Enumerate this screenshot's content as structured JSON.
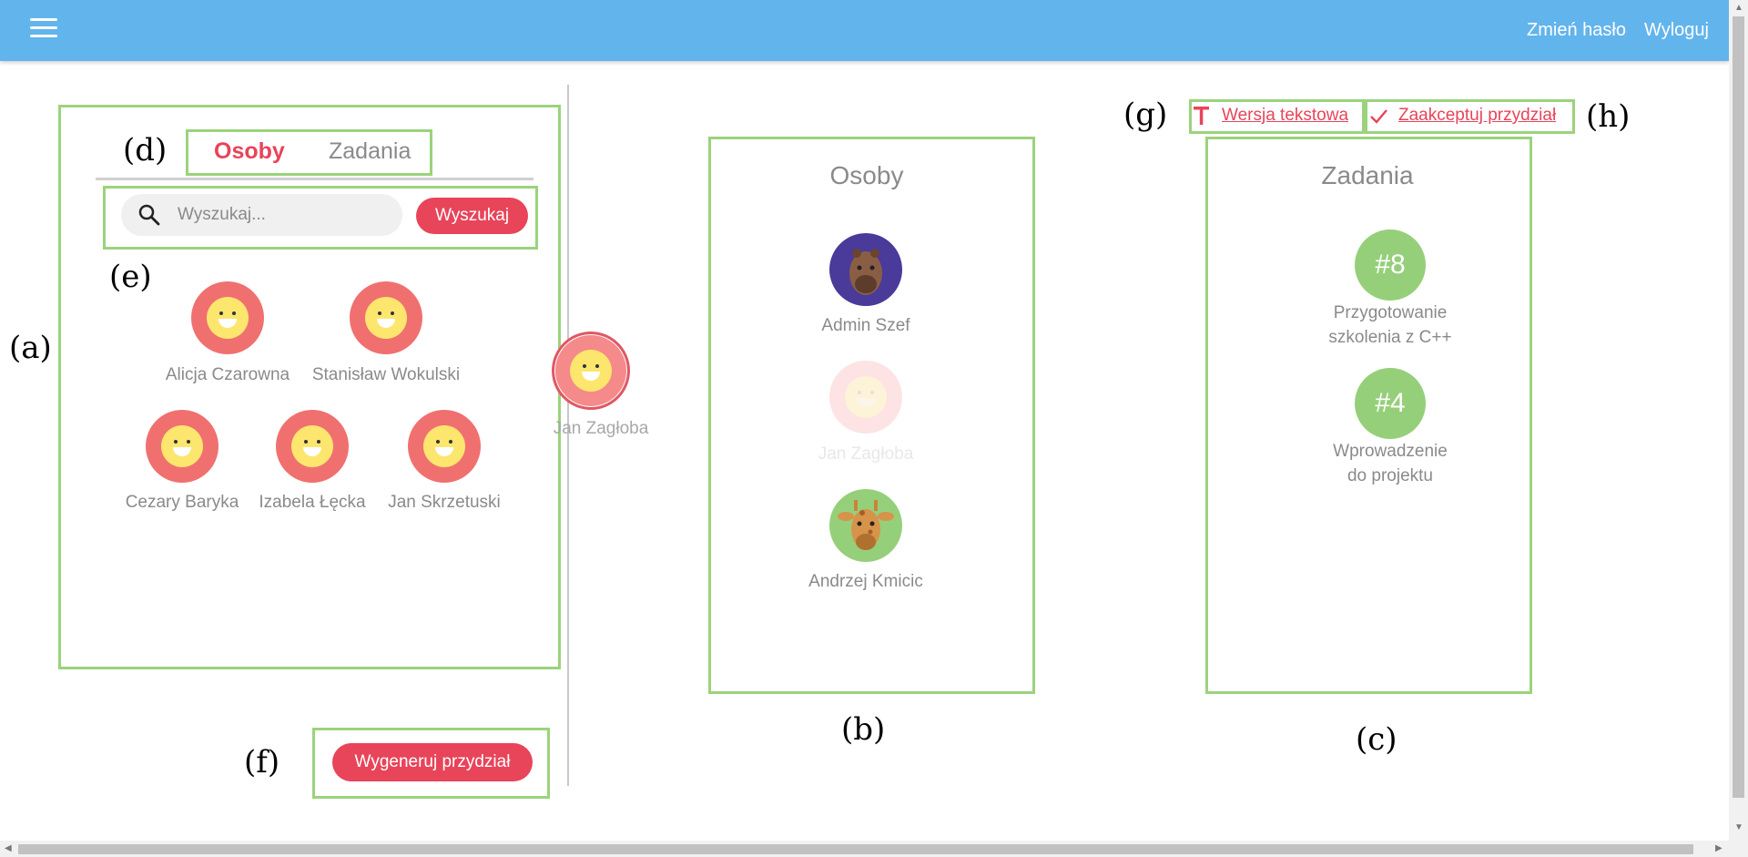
{
  "header": {
    "change_password": "Zmień hasło",
    "logout": "Wyloguj"
  },
  "annotations": {
    "a": "(a)",
    "b": "(b)",
    "c": "(c)",
    "d": "(d)",
    "e": "(e)",
    "f": "(f)",
    "g": "(g)",
    "h": "(h)"
  },
  "left_panel": {
    "tabs": [
      {
        "label": "Osoby",
        "active": true
      },
      {
        "label": "Zadania",
        "active": false
      }
    ],
    "search": {
      "placeholder": "Wyszukaj...",
      "button": "Wyszukaj"
    },
    "people": [
      {
        "name": "Alicja Czarowna"
      },
      {
        "name": "Stanisław Wokulski"
      },
      {
        "name": "Cezary Baryka"
      },
      {
        "name": "Izabela Łęcka"
      },
      {
        "name": "Jan Skrzetuski"
      }
    ],
    "generate_button": "Wygeneruj przydział"
  },
  "dragged_person": {
    "name": "Jan Zagłoba"
  },
  "persons_column": {
    "title": "Osoby",
    "people": [
      {
        "name": "Admin Szef",
        "avatar": "capybara-icon",
        "color": "#4a3a9a"
      },
      {
        "name": "Jan Zagłoba",
        "avatar": "smiley-icon",
        "faded": true
      },
      {
        "name": "Andrzej Kmicic",
        "avatar": "giraffe-icon",
        "color": "#96cf7a"
      }
    ]
  },
  "tasks_column": {
    "title": "Zadania",
    "tasks": [
      {
        "id": "#8",
        "title": "Przygotowanie szkolenia z C++",
        "line1": "Przygotowanie",
        "line2": "szkolenia z C++"
      },
      {
        "id": "#4",
        "title": "Wprowadzenie do projektu",
        "line1": "Wprowadzenie",
        "line2": "do projektu"
      }
    ]
  },
  "actions": {
    "text_version": "Wersja tekstowa",
    "accept": "Zaakceptuj przydział"
  },
  "colors": {
    "topbar": "#62b4ec",
    "accent_red": "#e8445a",
    "annotation_green": "#9bd37c",
    "task_green": "#96cf7a"
  }
}
